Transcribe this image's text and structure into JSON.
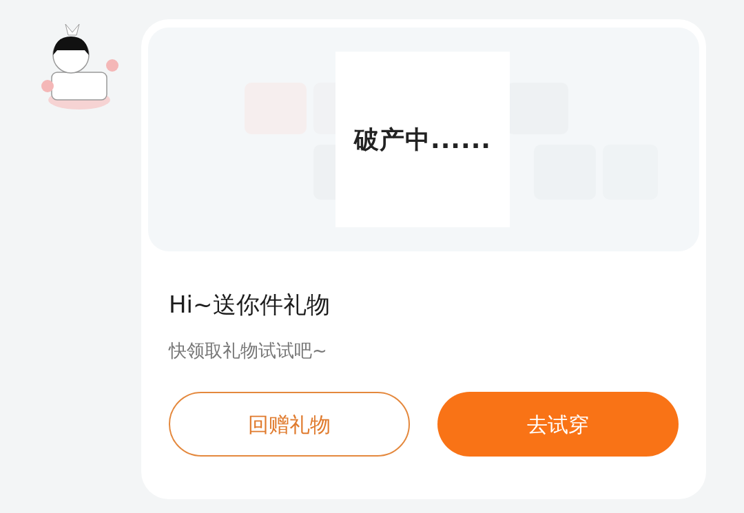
{
  "message": {
    "sticker_text": "破产中......",
    "title": "Hi~送你件礼物",
    "subtitle": "快领取礼物试试吧~",
    "buttons": [
      {
        "label": "回赠礼物",
        "kind": "outline"
      },
      {
        "label": "去试穿",
        "kind": "filled"
      }
    ]
  }
}
